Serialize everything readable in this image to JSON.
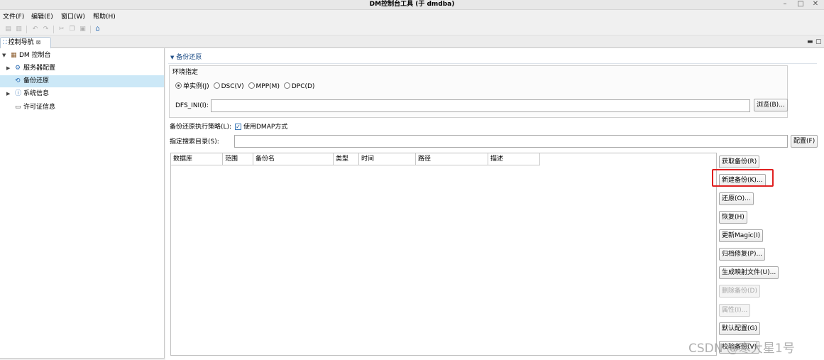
{
  "window": {
    "title": "DM控制台工具 (于 dmdba)",
    "controls": [
      "–",
      "□",
      "✕"
    ]
  },
  "menu": [
    "文件(F)",
    "编辑(E)",
    "窗口(W)",
    "帮助(H)"
  ],
  "nav_tab": {
    "label": "控制导航",
    "close": "⊠"
  },
  "tree": {
    "items": [
      {
        "label": "DM 控制台",
        "expanded": true,
        "icon": "console-icon"
      },
      {
        "label": "服务器配置",
        "expandable": true,
        "icon": "server-config-icon"
      },
      {
        "label": "备份还原",
        "selected": true,
        "icon": "backup-restore-icon"
      },
      {
        "label": "系统信息",
        "expandable": true,
        "icon": "info-icon"
      },
      {
        "label": "许可证信息",
        "icon": "license-icon"
      }
    ]
  },
  "section": {
    "title": "备份还原"
  },
  "env": {
    "title": "环境指定",
    "options": [
      "单实例(J)",
      "DSC(V)",
      "MPP(M)",
      "DPC(D)"
    ],
    "selected": "单实例(J)",
    "dfs_label": "DFS_INI(I):",
    "dfs_value": "",
    "browse_label": "浏览(B)..."
  },
  "strategy": {
    "label": "备份还原执行策略(L):",
    "checkbox_label": "使用DMAP方式",
    "checked": true
  },
  "search_dir": {
    "label": "指定搜索目录(S):",
    "value": "",
    "config_label": "配置(F)"
  },
  "table": {
    "columns": [
      "数据库",
      "范围",
      "备份名",
      "类型",
      "时间",
      "路径",
      "描述"
    ],
    "rows": []
  },
  "actions": [
    {
      "label": "获取备份(R)",
      "enabled": true
    },
    {
      "label": "新建备份(K)...",
      "enabled": true,
      "highlighted": true
    },
    {
      "label": "还原(O)...",
      "enabled": true
    },
    {
      "label": "恢复(H)",
      "enabled": true
    },
    {
      "label": "更新Magic(I)",
      "enabled": true
    },
    {
      "label": "归档修复(P)...",
      "enabled": true
    },
    {
      "label": "生成映射文件(U)...",
      "enabled": true
    },
    {
      "label": "删除备份(D)",
      "enabled": false
    },
    {
      "label": "属性(I)...",
      "enabled": false
    },
    {
      "label": "默认配置(G)",
      "enabled": true
    },
    {
      "label": "校验备份(V)",
      "enabled": true
    }
  ],
  "watermark": "CSDN @寒大星1号",
  "highlight_color": "#e02020"
}
